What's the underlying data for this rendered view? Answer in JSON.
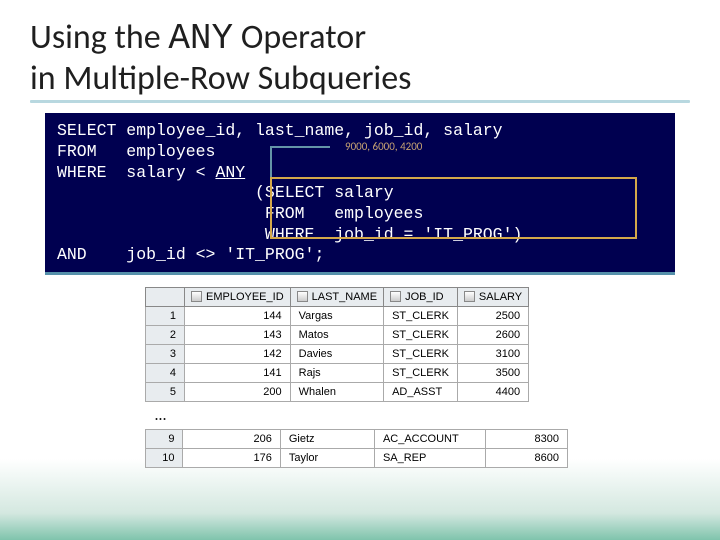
{
  "title_a": "Using the ",
  "title_mono": "ANY",
  "title_b": " Operator",
  "title_c": "in Multiple-Row Subqueries",
  "sql": {
    "l1": "SELECT employee_id, last_name, job_id, salary",
    "l2a": "FROM   employees",
    "l3a": "WHERE  salary < ",
    "l3b": "ANY",
    "l4": "                    (SELECT salary",
    "l5": "                     FROM   employees",
    "l6": "                     WHERE  job_id = 'IT_PROG')",
    "l7": "AND    job_id <> 'IT_PROG';"
  },
  "annotation": "9000, 6000, 4200",
  "table": {
    "cols": [
      "",
      "EMPLOYEE_ID",
      "LAST_NAME",
      "JOB_ID",
      "SALARY"
    ],
    "rows1": [
      {
        "n": "1",
        "emp": "144",
        "ln": "Vargas",
        "job": "ST_CLERK",
        "sal": "2500"
      },
      {
        "n": "2",
        "emp": "143",
        "ln": "Matos",
        "job": "ST_CLERK",
        "sal": "2600"
      },
      {
        "n": "3",
        "emp": "142",
        "ln": "Davies",
        "job": "ST_CLERK",
        "sal": "3100"
      },
      {
        "n": "4",
        "emp": "141",
        "ln": "Rajs",
        "job": "ST_CLERK",
        "sal": "3500"
      },
      {
        "n": "5",
        "emp": "200",
        "ln": "Whalen",
        "job": "AD_ASST",
        "sal": "4400"
      }
    ],
    "rows2": [
      {
        "n": "9",
        "emp": "206",
        "ln": "Gietz",
        "job": "AC_ACCOUNT",
        "sal": "8300"
      },
      {
        "n": "10",
        "emp": "176",
        "ln": "Taylor",
        "job": "SA_REP",
        "sal": "8600"
      }
    ]
  },
  "dots": "…"
}
